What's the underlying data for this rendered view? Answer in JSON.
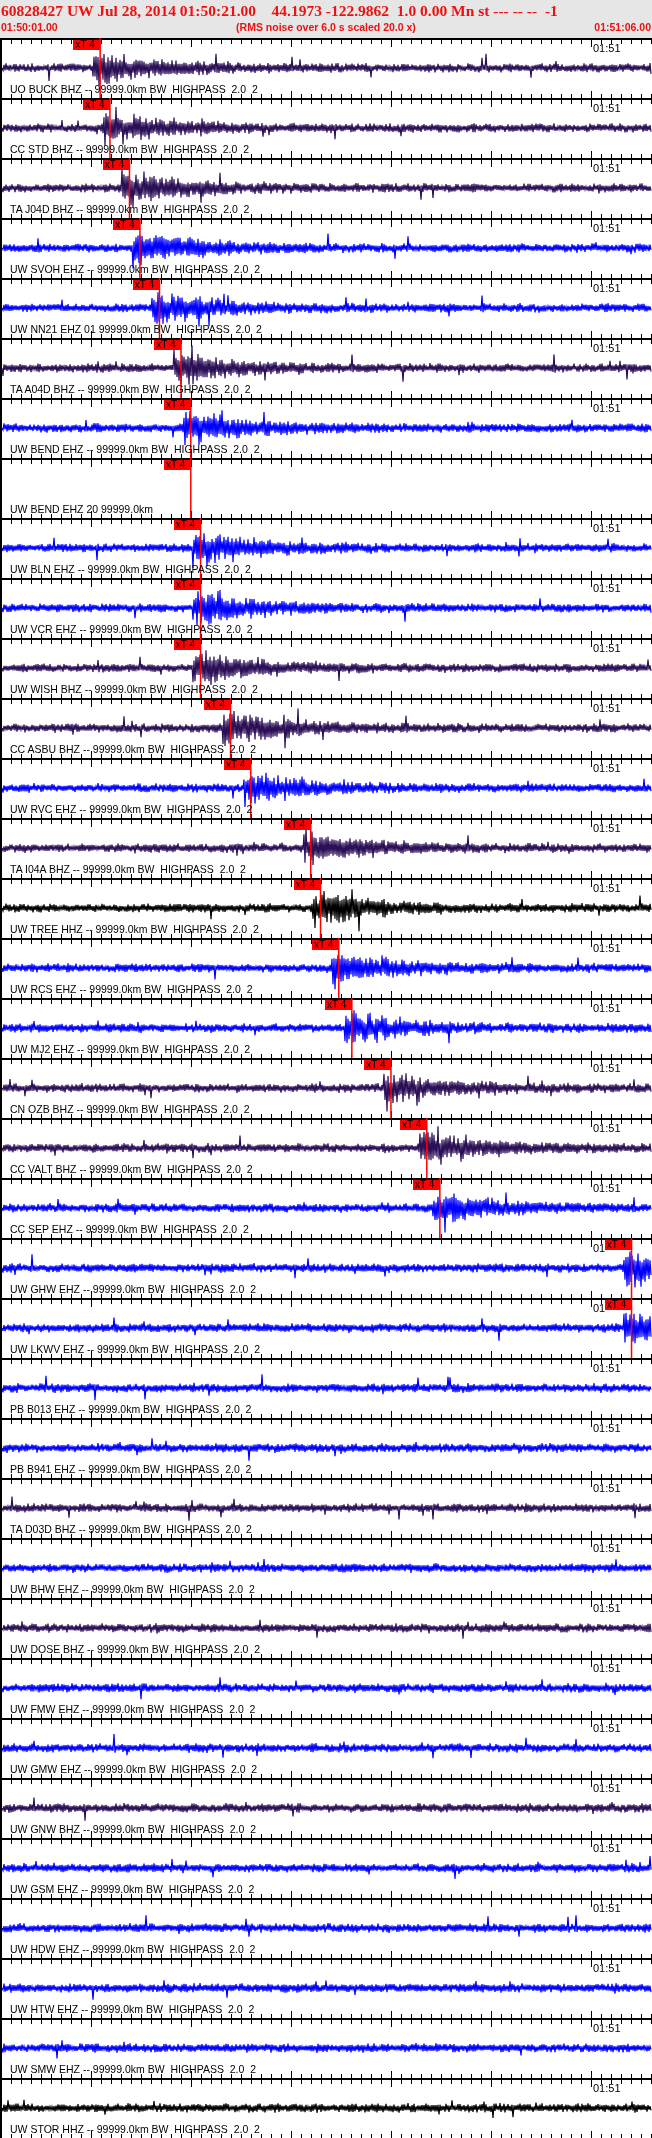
{
  "header": {
    "event_line": "60828427 UW Jul 28, 2014 01:50:21.00    44.1973 -122.9862  1.0 0.00 Mn st --- -- --  -1",
    "start_time": "01:50:01.00",
    "note": "(RMS noise over 6.0 s scaled 20.0 x)",
    "end_time": "01:51:06.00"
  },
  "traces": [
    {
      "kind": "trace",
      "label": "UO BUCK BHZ -- 99999.0km BW  HIGHPASS  2.0  2",
      "time_mark": "01:51",
      "color": "#2b0f57",
      "pick": {
        "label": "xT 4",
        "level": 0.154
      }
    },
    {
      "kind": "trace",
      "label": "CC STD BHZ -- 99999.0km BW  HIGHPASS  2.0  2",
      "time_mark": "01:51",
      "color": "#2b0f57",
      "pick": {
        "label": "xT 4",
        "level": 0.169
      }
    },
    {
      "kind": "trace",
      "label": "TA J04D BHZ -- 99999.0km BW  HIGHPASS  2.0  2",
      "time_mark": "01:51",
      "color": "#2b0f57",
      "pick": {
        "label": "xT 4",
        "level": 0.199
      }
    },
    {
      "kind": "trace",
      "label": "UW SVOH EHZ -- 99999.0km BW  HIGHPASS  2.0  2",
      "time_mark": "01:51",
      "color": "#0000ff",
      "pick": {
        "label": "xT 4",
        "level": 0.215
      }
    },
    {
      "kind": "trace",
      "label": "UW NN21 EHZ 01 99999.0km BW  HIGHPASS  2.0  2",
      "time_mark": "01:51",
      "color": "#0000ff",
      "pick": {
        "label": "xT 4",
        "level": 0.245
      }
    },
    {
      "kind": "trace",
      "label": "TA A04D BHZ -- 99999.0km BW  HIGHPASS  2.0  2",
      "time_mark": "01:51",
      "color": "#2b0f57",
      "pick": {
        "label": "xT 4",
        "level": 0.278
      }
    },
    {
      "kind": "trace",
      "label": "UW BEND EHZ -- 99999.0km BW  HIGHPASS  2.0  2",
      "time_mark": "01:51",
      "color": "#0000ff",
      "pick": {
        "label": "xT 4",
        "level": 0.293
      }
    },
    {
      "kind": "empty",
      "label": "UW BEND EHZ 20 99999.0km",
      "pick": {
        "label": "xT 4",
        "level": 0.293
      }
    },
    {
      "kind": "trace",
      "label": "UW BLN EHZ -- 99999.0km BW  HIGHPASS  2.0  2",
      "time_mark": "01:51",
      "color": "#0000ff",
      "pick": {
        "label": "xT 4",
        "level": 0.308
      }
    },
    {
      "kind": "trace",
      "label": "UW VCR EHZ -- 99999.0km BW  HIGHPASS  2.0  2",
      "time_mark": "01:51",
      "color": "#0000ff",
      "pick": {
        "label": "xT 4",
        "level": 0.308
      }
    },
    {
      "kind": "trace",
      "label": "UW WISH BHZ -- 99999.0km BW  HIGHPASS  2.0  2",
      "time_mark": "01:51",
      "color": "#2b0f57",
      "pick": {
        "label": "xT 4",
        "level": 0.308
      }
    },
    {
      "kind": "trace",
      "label": "CC ASBU BHZ -- 99999.0km BW  HIGHPASS  2.0  2",
      "time_mark": "01:51",
      "color": "#2b0f57",
      "pick": {
        "label": "xT 4",
        "level": 0.354
      }
    },
    {
      "kind": "trace",
      "label": "UW RVC EHZ -- 99999.0km BW  HIGHPASS  2.0  2",
      "time_mark": "01:51",
      "color": "#0000ff",
      "pick": {
        "label": "xT 4",
        "level": 0.385
      }
    },
    {
      "kind": "trace",
      "label": "TA I04A BHZ -- 99999.0km BW  HIGHPASS  2.0  2",
      "time_mark": "01:51",
      "color": "#2b0f57",
      "pick": {
        "label": "xT 4",
        "level": 0.477
      }
    },
    {
      "kind": "trace",
      "label": "UW TREE HHZ -- 99999.0km BW  HIGHPASS  2.0  2",
      "time_mark": "01:51",
      "color": "#000000",
      "pick": {
        "label": "xT 4",
        "level": 0.492
      }
    },
    {
      "kind": "trace",
      "label": "UW RCS EHZ -- 99999.0km BW  HIGHPASS  2.0  2",
      "time_mark": "01:51",
      "color": "#0000ff",
      "pick": {
        "label": "xT 4",
        "level": 0.52
      }
    },
    {
      "kind": "trace",
      "label": "UW MJ2 EHZ -- 99999.0km BW  HIGHPASS  2.0  2",
      "time_mark": "01:51",
      "color": "#0000ff",
      "pick": {
        "label": "xT 4",
        "level": 0.54
      }
    },
    {
      "kind": "trace",
      "label": "CN OZB BHZ -- 99999.0km BW  HIGHPASS  2.0  2",
      "time_mark": "01:51",
      "color": "#2b0f57",
      "pick": {
        "label": "xT 4",
        "level": 0.6
      }
    },
    {
      "kind": "trace",
      "label": "CC VALT BHZ -- 99999.0km BW  HIGHPASS  2.0  2",
      "time_mark": "01:51",
      "color": "#2b0f57",
      "pick": {
        "label": "xT 4",
        "level": 0.655
      }
    },
    {
      "kind": "trace",
      "label": "CC SEP EHZ -- 99999.0km BW  HIGHPASS  2.0  2",
      "time_mark": "01:51",
      "color": "#0000ff",
      "pick": {
        "label": "xT 4",
        "level": 0.675
      }
    },
    {
      "kind": "trace",
      "label": "UW GHW EHZ -- 99999.0km BW  HIGHPASS  2.0  2",
      "time_mark": "01",
      "color": "#0000ff",
      "pick": {
        "label": "xT 4",
        "level": 0.969
      }
    },
    {
      "kind": "trace",
      "label": "UW LKWV EHZ -- 99999.0km BW  HIGHPASS  2.0  2",
      "time_mark": "01",
      "color": "#0000ff",
      "pick": {
        "label": "xT 4",
        "level": 0.969
      }
    },
    {
      "kind": "trace",
      "label": "PB B013 EHZ -- 99999.0km BW  HIGHPASS  2.0  2",
      "time_mark": "01:51",
      "color": "#0000ff"
    },
    {
      "kind": "trace",
      "label": "PB B941 EHZ -- 99999.0km BW  HIGHPASS  2.0  2",
      "time_mark": "01:51",
      "color": "#0000ff"
    },
    {
      "kind": "trace",
      "label": "TA D03D BHZ -- 99999.0km BW  HIGHPASS  2.0  2",
      "time_mark": "01:51",
      "color": "#2b0f57"
    },
    {
      "kind": "trace",
      "label": "UW BHW EHZ -- 99999.0km BW  HIGHPASS  2.0  2",
      "time_mark": "01:51",
      "color": "#0000ff"
    },
    {
      "kind": "trace",
      "label": "UW DOSE BHZ -- 99999.0km BW  HIGHPASS  2.0  2",
      "time_mark": "01:51",
      "color": "#2b0f57"
    },
    {
      "kind": "trace",
      "label": "UW FMW EHZ -- 99999.0km BW  HIGHPASS  2.0  2",
      "time_mark": "01:51",
      "color": "#0000ff"
    },
    {
      "kind": "trace",
      "label": "UW GMW EHZ -- 99999.0km BW  HIGHPASS  2.0  2",
      "time_mark": "01:51",
      "color": "#0000ff"
    },
    {
      "kind": "trace",
      "label": "UW GNW BHZ -- 99999.0km BW  HIGHPASS  2.0  2",
      "time_mark": "01:51",
      "color": "#2b0f57"
    },
    {
      "kind": "trace",
      "label": "UW GSM EHZ -- 99999.0km BW  HIGHPASS  2.0  2",
      "time_mark": "01:51",
      "color": "#0000ff"
    },
    {
      "kind": "trace",
      "label": "UW HDW EHZ -- 99999.0km BW  HIGHPASS  2.0  2",
      "time_mark": "01:51",
      "color": "#0000ff"
    },
    {
      "kind": "trace",
      "label": "UW HTW EHZ -- 99999.0km BW  HIGHPASS  2.0  2",
      "time_mark": "01:51",
      "color": "#0000ff"
    },
    {
      "kind": "trace",
      "label": "UW SMW EHZ -- 99999.0km BW  HIGHPASS  2.0  2",
      "time_mark": "01:51",
      "color": "#0000ff"
    },
    {
      "kind": "trace",
      "label": "UW STOR HHZ -- 99999.0km BW  HIGHPASS  2.0  2",
      "time_mark": "01:51",
      "color": "#000000"
    }
  ]
}
